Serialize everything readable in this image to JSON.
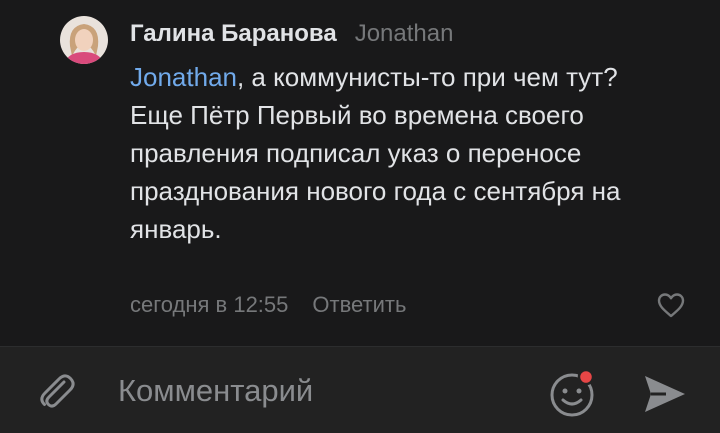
{
  "comment": {
    "author": "Галина Баранова",
    "reply_to": "Jonathan",
    "mention": "Jonathan",
    "text_line1_rest": ", а коммунисты-то при чем тут?",
    "text_para2": "Еще Пётр Первый во времена своего правления подписал указ о переносе празднования  нового года с сентября на январь.",
    "timestamp": "сегодня в 12:55",
    "reply_label": "Ответить"
  },
  "composer": {
    "placeholder": "Комментарий"
  },
  "icons": {
    "avatar": "avatar",
    "like": "heart-outline-icon",
    "attach": "paperclip-icon",
    "emoji": "smiley-icon",
    "send": "send-arrow-icon"
  },
  "colors": {
    "background": "#19191a",
    "composer_bg": "#222222",
    "primary_text": "#e1e3e6",
    "secondary_text": "#76787a",
    "mention": "#71aaeb",
    "notification_dot": "#e64646"
  }
}
